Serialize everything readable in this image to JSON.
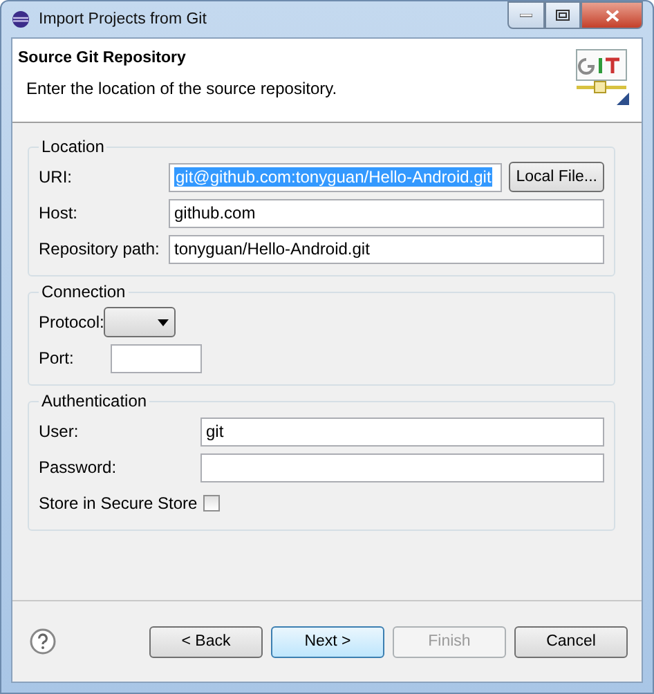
{
  "window": {
    "title": "Import Projects from Git"
  },
  "header": {
    "title": "Source Git Repository",
    "description": "Enter the location of the source repository."
  },
  "groups": [
    {
      "title": "Location",
      "fields": [
        {
          "kind": "text",
          "label": "URI:",
          "value": "git@github.com:tonyguan/Hello-Android.git",
          "selected": true,
          "button": "Local File..."
        },
        {
          "kind": "text",
          "label": "Host:",
          "value": "github.com"
        },
        {
          "kind": "text",
          "label": "Repository path:",
          "value": "tonyguan/Hello-Android.git"
        }
      ]
    },
    {
      "title": "Connection",
      "fields": [
        {
          "kind": "dropdown",
          "label": "Protocol:"
        },
        {
          "kind": "short",
          "label": "Port:"
        }
      ]
    },
    {
      "title": "Authentication",
      "fields": [
        {
          "kind": "text",
          "label": "User:",
          "value": "git"
        },
        {
          "kind": "text",
          "label": "Password:"
        },
        {
          "kind": "checkbox",
          "label": "Store in Secure Store",
          "checked": false
        }
      ]
    }
  ],
  "buttons": [
    {
      "label": "< Back",
      "disabled": false,
      "default": false
    },
    {
      "label": "Next >",
      "disabled": false,
      "default": true
    },
    {
      "label": "Finish",
      "disabled": true,
      "default": false
    },
    {
      "label": "Cancel",
      "disabled": false,
      "default": false
    }
  ]
}
